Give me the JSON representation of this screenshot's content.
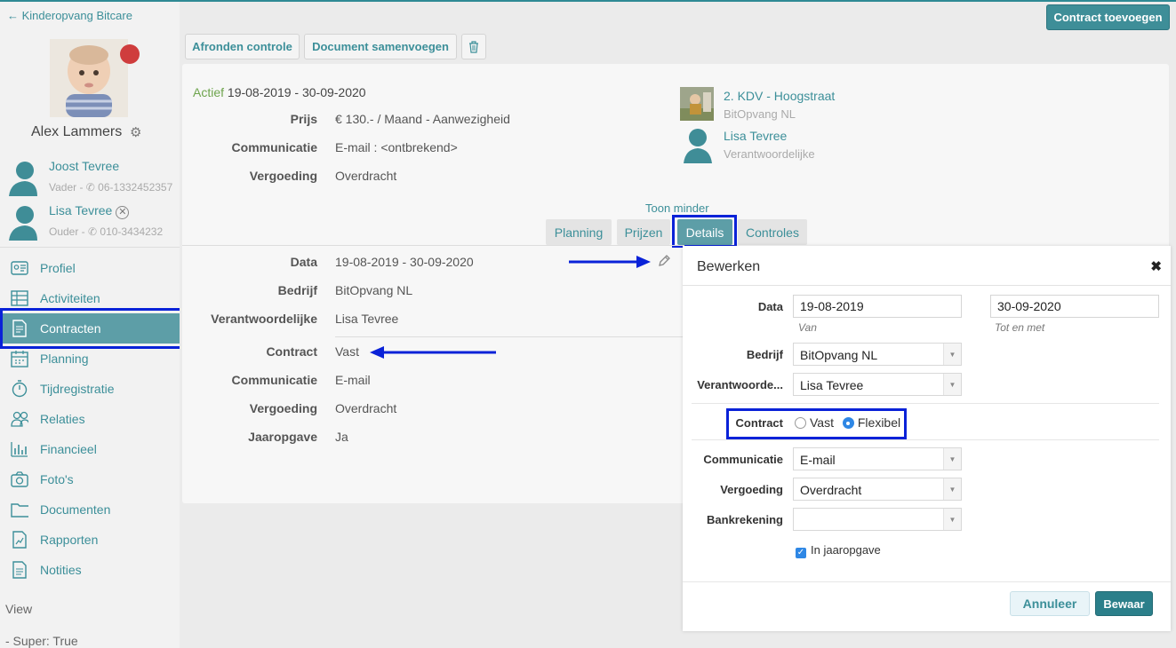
{
  "sidebar": {
    "back_link": "Kinderopvang Bitcare",
    "child_name": "Alex Lammers",
    "relations": [
      {
        "name": "Joost Tevree",
        "sub": "Vader - ✆ 06-1332452357"
      },
      {
        "name": "Lisa Tevree",
        "sub": "Ouder - ✆ 010-3434232"
      }
    ],
    "nav": [
      {
        "label": "Profiel",
        "icon": "profile-card-icon"
      },
      {
        "label": "Activiteiten",
        "icon": "table-icon"
      },
      {
        "label": "Contracten",
        "icon": "document-icon"
      },
      {
        "label": "Planning",
        "icon": "calendar-icon"
      },
      {
        "label": "Tijdregistratie",
        "icon": "stopwatch-icon"
      },
      {
        "label": "Relaties",
        "icon": "people-icon"
      },
      {
        "label": "Financieel",
        "icon": "bar-chart-icon"
      },
      {
        "label": "Foto's",
        "icon": "camera-icon"
      },
      {
        "label": "Documenten",
        "icon": "folder-icon"
      },
      {
        "label": "Rapporten",
        "icon": "report-icon"
      },
      {
        "label": "Notities",
        "icon": "note-icon"
      }
    ],
    "view_label": "View",
    "super_label": "- Super: True"
  },
  "header": {
    "add_contract": "Contract toevoegen",
    "finish_check": "Afronden controle",
    "merge_document": "Document samenvoegen"
  },
  "contract": {
    "status": "Actief",
    "period": "19-08-2019 - 30-09-2020",
    "summary": [
      {
        "label": "Prijs",
        "value": "€ 130.- / Maand - Aanwezigheid"
      },
      {
        "label": "Communicatie",
        "value": "E-mail : <ontbrekend>"
      },
      {
        "label": "Vergoeding",
        "value": "Overdracht"
      }
    ],
    "location_name": "2. KDV - Hoogstraat",
    "location_org": "BitOpvang NL",
    "responsible_name": "Lisa Tevree",
    "responsible_role": "Verantwoordelijke",
    "toggle_less": "Toon minder",
    "tabs": [
      "Planning",
      "Prijzen",
      "Details",
      "Controles"
    ],
    "active_tab": "Details",
    "details": [
      {
        "label": "Data",
        "value": "19-08-2019 - 30-09-2020"
      },
      {
        "label": "Bedrijf",
        "value": "BitOpvang NL"
      },
      {
        "label": "Verantwoordelijke",
        "value": "Lisa Tevree"
      },
      {
        "label": "Contract",
        "value": "Vast"
      },
      {
        "label": "Communicatie",
        "value": "E-mail"
      },
      {
        "label": "Vergoeding",
        "value": "Overdracht"
      },
      {
        "label": "Jaaropgave",
        "value": "Ja"
      }
    ]
  },
  "modal": {
    "title": "Bewerken",
    "close": "✖",
    "data_label": "Data",
    "from_value": "19-08-2019",
    "from_hint": "Van",
    "to_value": "30-09-2020",
    "to_hint": "Tot en met",
    "company_label": "Bedrijf",
    "company_value": "BitOpvang NL",
    "responsible_label": "Verantwoorde...",
    "responsible_value": "Lisa Tevree",
    "contract_label": "Contract",
    "contract_options": [
      "Vast",
      "Flexibel"
    ],
    "contract_selected": "Flexibel",
    "communication_label": "Communicatie",
    "communication_value": "E-mail",
    "compensation_label": "Vergoeding",
    "compensation_value": "Overdracht",
    "bank_label": "Bankrekening",
    "bank_value": "",
    "annual_label": "In jaaropgave",
    "annual_checked": true,
    "cancel": "Annuleer",
    "save": "Bewaar"
  },
  "colors": {
    "accent": "#3e8e98",
    "active_nav": "#5d9ea7",
    "status_active": "#6ea44d",
    "highlight": "#0a22d8",
    "radio_selected": "#2e87e5",
    "status_dot": "#cf3d3d"
  }
}
